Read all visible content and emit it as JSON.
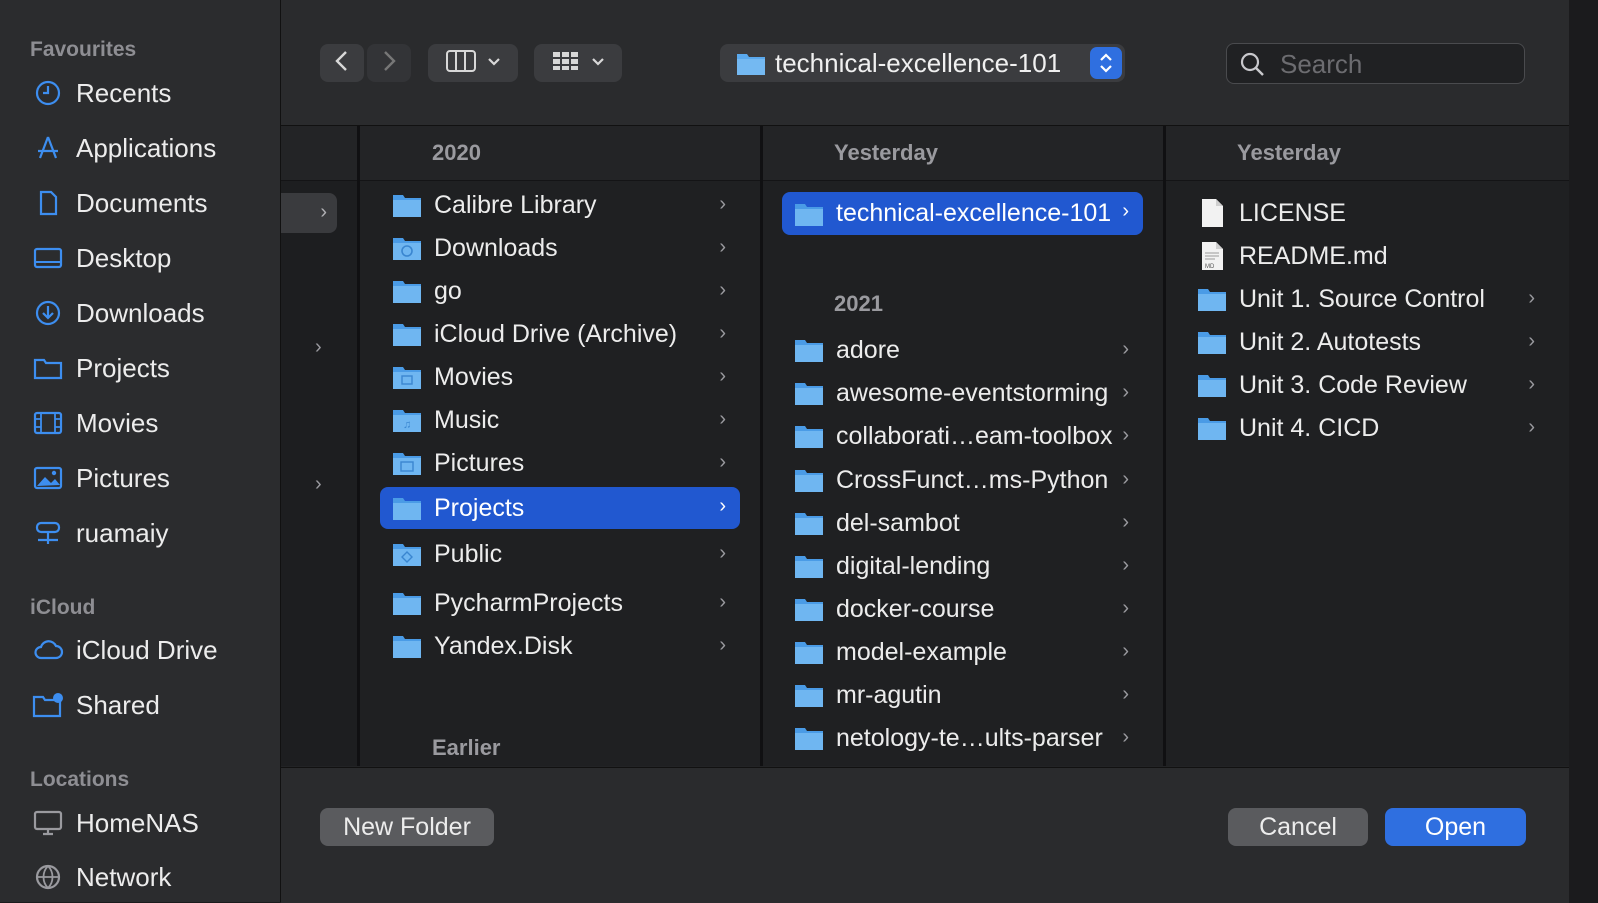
{
  "sidebar": {
    "sections": [
      {
        "title": "Favourites"
      },
      {
        "title": "iCloud"
      },
      {
        "title": "Locations"
      }
    ],
    "favourites": [
      {
        "label": "Recents",
        "icon": "clock-icon"
      },
      {
        "label": "Applications",
        "icon": "applications-icon"
      },
      {
        "label": "Documents",
        "icon": "document-icon"
      },
      {
        "label": "Desktop",
        "icon": "desktop-icon"
      },
      {
        "label": "Downloads",
        "icon": "download-icon"
      },
      {
        "label": "Projects",
        "icon": "folder-icon"
      },
      {
        "label": "Movies",
        "icon": "film-icon"
      },
      {
        "label": "Pictures",
        "icon": "photo-icon"
      },
      {
        "label": "ruamaiy",
        "icon": "network-drive-icon"
      }
    ],
    "icloud": [
      {
        "label": "iCloud Drive",
        "icon": "cloud-icon"
      },
      {
        "label": "Shared",
        "icon": "shared-folder-icon"
      }
    ],
    "locations": [
      {
        "label": "HomeNAS",
        "icon": "monitor-icon"
      },
      {
        "label": "Network",
        "icon": "globe-icon"
      }
    ]
  },
  "toolbar": {
    "path": "technical-excellence-101",
    "search_placeholder": "Search"
  },
  "columns": {
    "col1": {
      "header": "2020",
      "items": [
        {
          "label": "Calibre Library"
        },
        {
          "label": "Downloads"
        },
        {
          "label": "go"
        },
        {
          "label": "iCloud Drive (Archive)"
        },
        {
          "label": "Movies"
        },
        {
          "label": "Music"
        },
        {
          "label": "Pictures"
        },
        {
          "label": "Projects"
        },
        {
          "label": "Public"
        },
        {
          "label": "PycharmProjects"
        },
        {
          "label": "Yandex.Disk"
        }
      ],
      "earlier": "Earlier"
    },
    "col2": {
      "header": "Yesterday",
      "selected": "technical-excellence-101",
      "group": "2021",
      "items": [
        {
          "label": "adore"
        },
        {
          "label": "awesome-eventstorming"
        },
        {
          "label": "collaborati…eam-toolbox"
        },
        {
          "label": "CrossFunct…ms-Python"
        },
        {
          "label": "del-sambot"
        },
        {
          "label": "digital-lending"
        },
        {
          "label": "docker-course"
        },
        {
          "label": "model-example"
        },
        {
          "label": "mr-agutin"
        },
        {
          "label": "netology-te…ults-parser"
        }
      ]
    },
    "col3": {
      "header": "Yesterday",
      "files": [
        {
          "label": "LICENSE"
        },
        {
          "label": "README.md"
        }
      ],
      "folders": [
        {
          "label": "Unit 1. Source Control"
        },
        {
          "label": "Unit 2. Autotests"
        },
        {
          "label": "Unit 3. Code Review"
        },
        {
          "label": "Unit 4. CICD"
        }
      ]
    }
  },
  "footer": {
    "new_folder": "New Folder",
    "cancel": "Cancel",
    "open": "Open"
  },
  "colors": {
    "accent": "#2f6fe0",
    "selection": "#2158d0",
    "folder": "#5aa9ee"
  }
}
